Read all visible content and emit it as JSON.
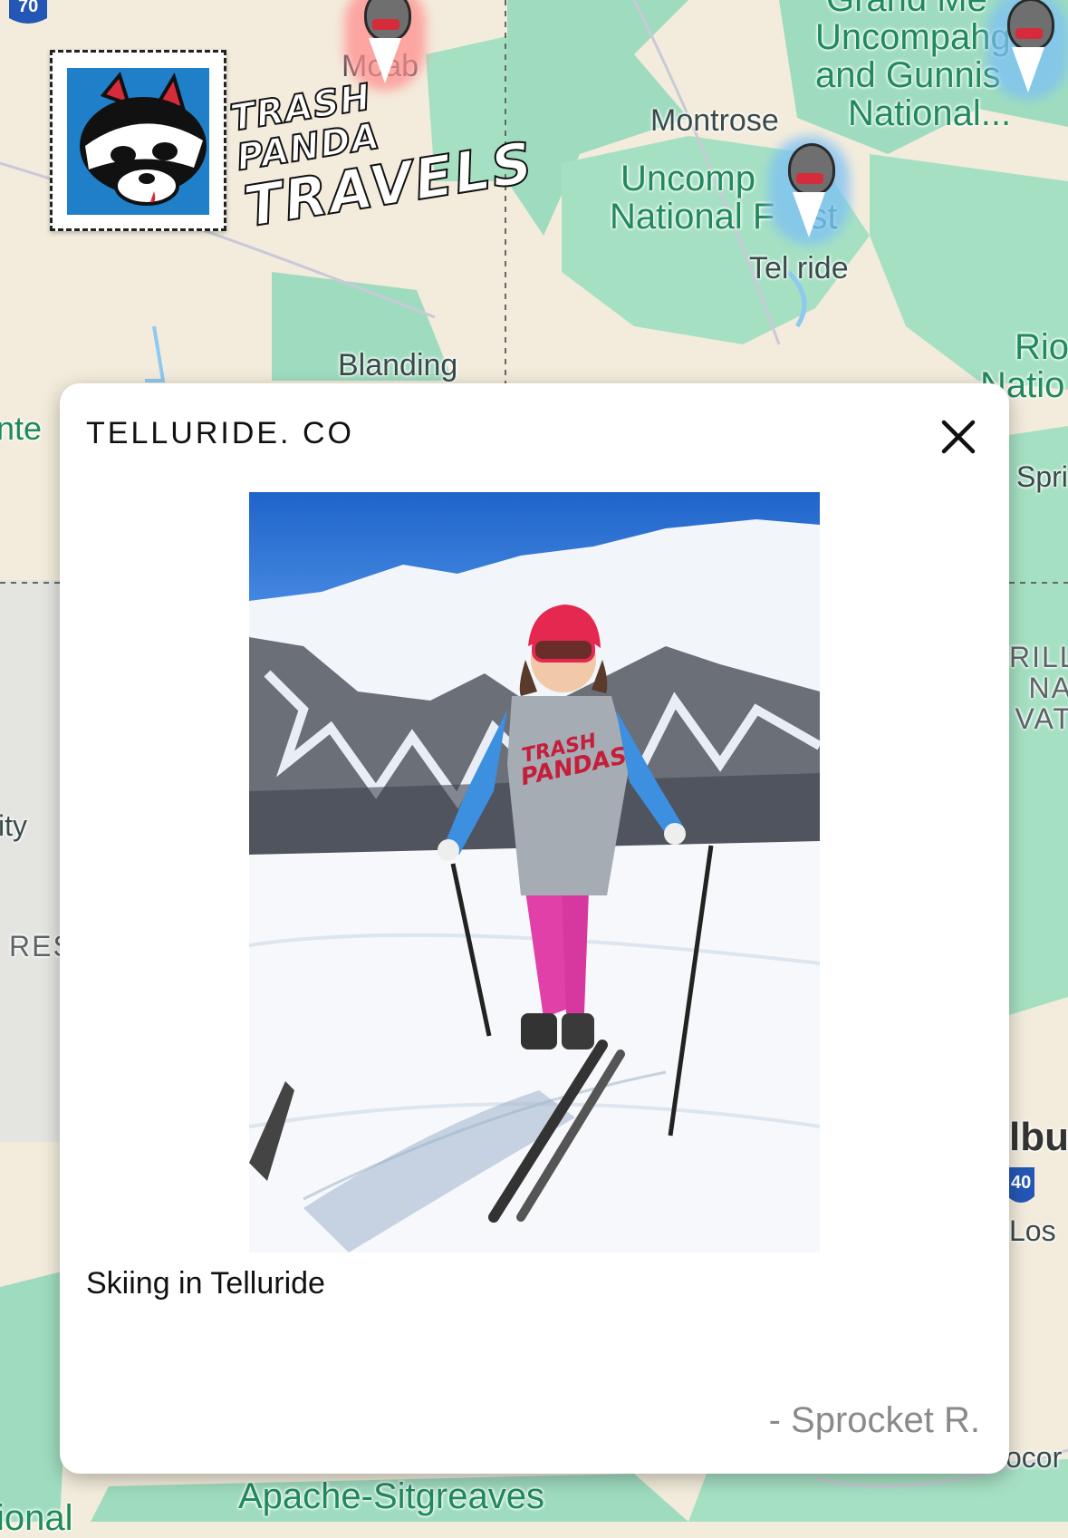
{
  "map": {
    "labels": {
      "moab": "Moab",
      "montrose": "Montrose",
      "uncompahgre_gunnison": [
        "Grand Me",
        "Uncompahg",
        "and Gunnis",
        "National..."
      ],
      "uncompahgre_nf": [
        "Uncomp",
        "National F",
        "st"
      ],
      "telluride": "Tel  ride",
      "blanding": "Blanding",
      "rio": [
        "Rio",
        "Natio"
      ],
      "spri": "Spri",
      "rill": [
        "RILL",
        "NA",
        "VAT"
      ],
      "ity": "ity",
      "res": "RES",
      "ite": "nte",
      "albu": "lbu",
      "los": "Los",
      "ocor": "ocor",
      "apache": "Apache-Sitgreaves",
      "ional": "ional",
      "highway_70": "70",
      "highway_40": "40"
    },
    "colors": {
      "land": "#f3ecdc",
      "forest": "#9fdcbf",
      "water": "#8ec9f0"
    }
  },
  "logo": {
    "line1": "TRASH PANDA",
    "line2": "TRAVELS"
  },
  "modal": {
    "title": "TELLURIDE. CO",
    "close_icon": "close-icon",
    "caption": "Skiing in Telluride",
    "author": "- Sprocket R."
  }
}
